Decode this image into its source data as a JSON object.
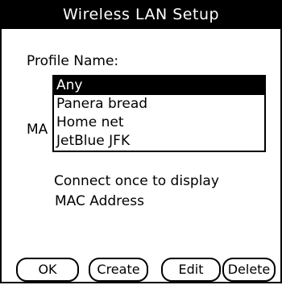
{
  "window": {
    "title": "Wireless LAN Setup"
  },
  "form": {
    "profile_label": "Profile Name:",
    "mac_label_partial": "MA",
    "connect_line1": "Connect once to display",
    "connect_line2": "MAC Address"
  },
  "dropdown": {
    "selected_index": 0,
    "items": [
      {
        "label": "Any"
      },
      {
        "label": "Panera bread"
      },
      {
        "label": "Home net"
      },
      {
        "label": "JetBlue JFK"
      }
    ]
  },
  "buttons": {
    "ok": "OK",
    "create": "Create",
    "edit": "Edit",
    "delete": "Delete"
  },
  "colors": {
    "titlebar_bg": "#000000",
    "selection_bg": "#000000",
    "background": "#ffffff"
  }
}
